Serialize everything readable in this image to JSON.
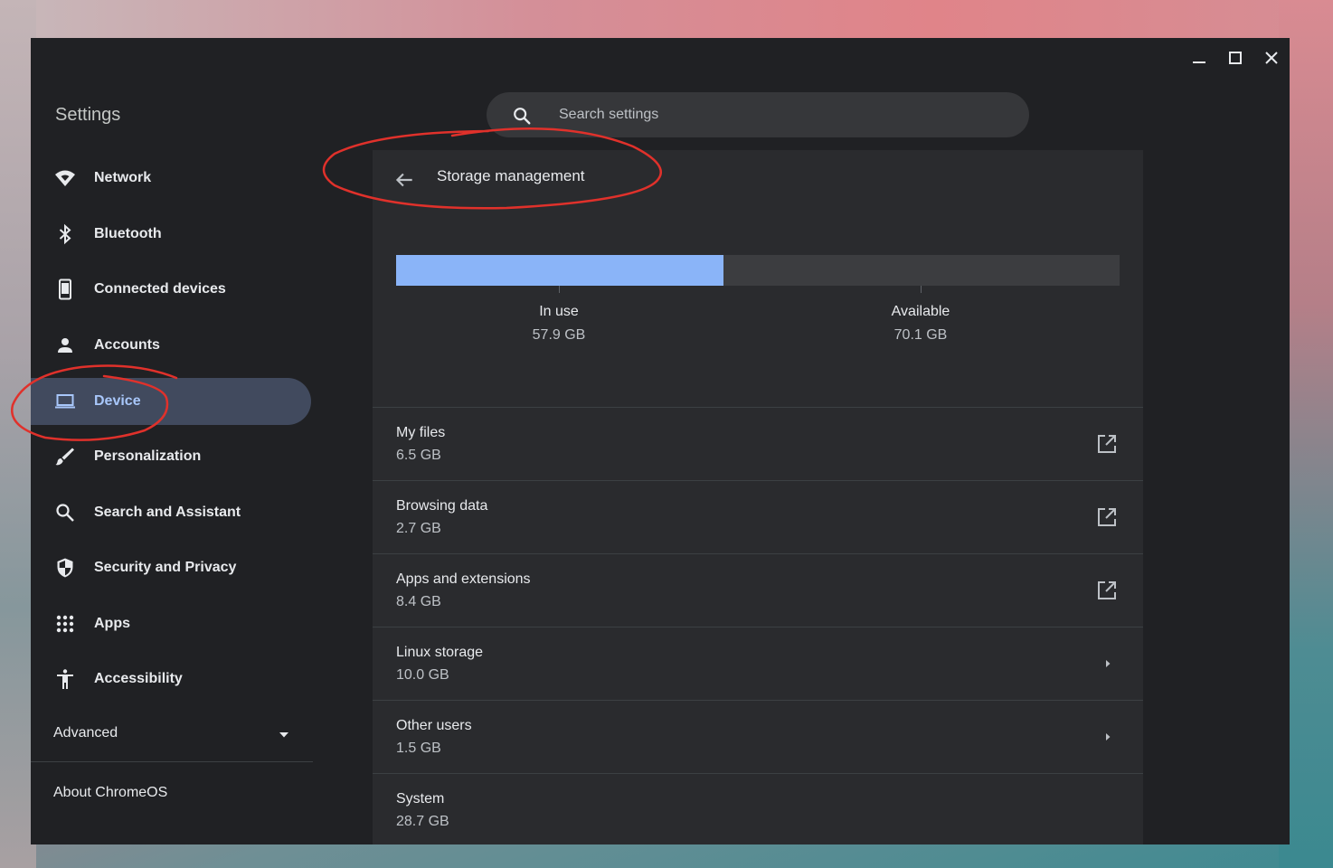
{
  "app": {
    "title": "Settings"
  },
  "search": {
    "placeholder": "Search settings"
  },
  "sidebar": {
    "items": [
      {
        "label": "Network",
        "icon": "wifi-icon"
      },
      {
        "label": "Bluetooth",
        "icon": "bluetooth-icon"
      },
      {
        "label": "Connected devices",
        "icon": "phone-icon"
      },
      {
        "label": "Accounts",
        "icon": "person-icon"
      },
      {
        "label": "Device",
        "icon": "laptop-icon",
        "active": true
      },
      {
        "label": "Personalization",
        "icon": "brush-icon"
      },
      {
        "label": "Search and Assistant",
        "icon": "search-icon"
      },
      {
        "label": "Security and Privacy",
        "icon": "shield-icon"
      },
      {
        "label": "Apps",
        "icon": "apps-grid-icon"
      },
      {
        "label": "Accessibility",
        "icon": "accessibility-icon"
      }
    ],
    "advanced_label": "Advanced",
    "about_label": "About ChromeOS"
  },
  "page": {
    "title": "Storage management"
  },
  "storage": {
    "in_use_label": "In use",
    "in_use_value": "57.9 GB",
    "available_label": "Available",
    "available_value": "70.1 GB",
    "used_fraction": 0.452
  },
  "rows": [
    {
      "name": "My files",
      "size": "6.5 GB",
      "action": "open-external-icon"
    },
    {
      "name": "Browsing data",
      "size": "2.7 GB",
      "action": "open-external-icon"
    },
    {
      "name": "Apps and extensions",
      "size": "8.4 GB",
      "action": "open-external-icon"
    },
    {
      "name": "Linux storage",
      "size": "10.0 GB",
      "action": "chevron-right-icon"
    },
    {
      "name": "Other users",
      "size": "1.5 GB",
      "action": "chevron-right-icon"
    },
    {
      "name": "System",
      "size": "28.7 GB",
      "action": ""
    }
  ],
  "colors": {
    "accent": "#8ab4f8",
    "active_nav_bg": "#414a5e",
    "active_nav_text": "#a8c7fa",
    "annotation": "#e0312b"
  }
}
